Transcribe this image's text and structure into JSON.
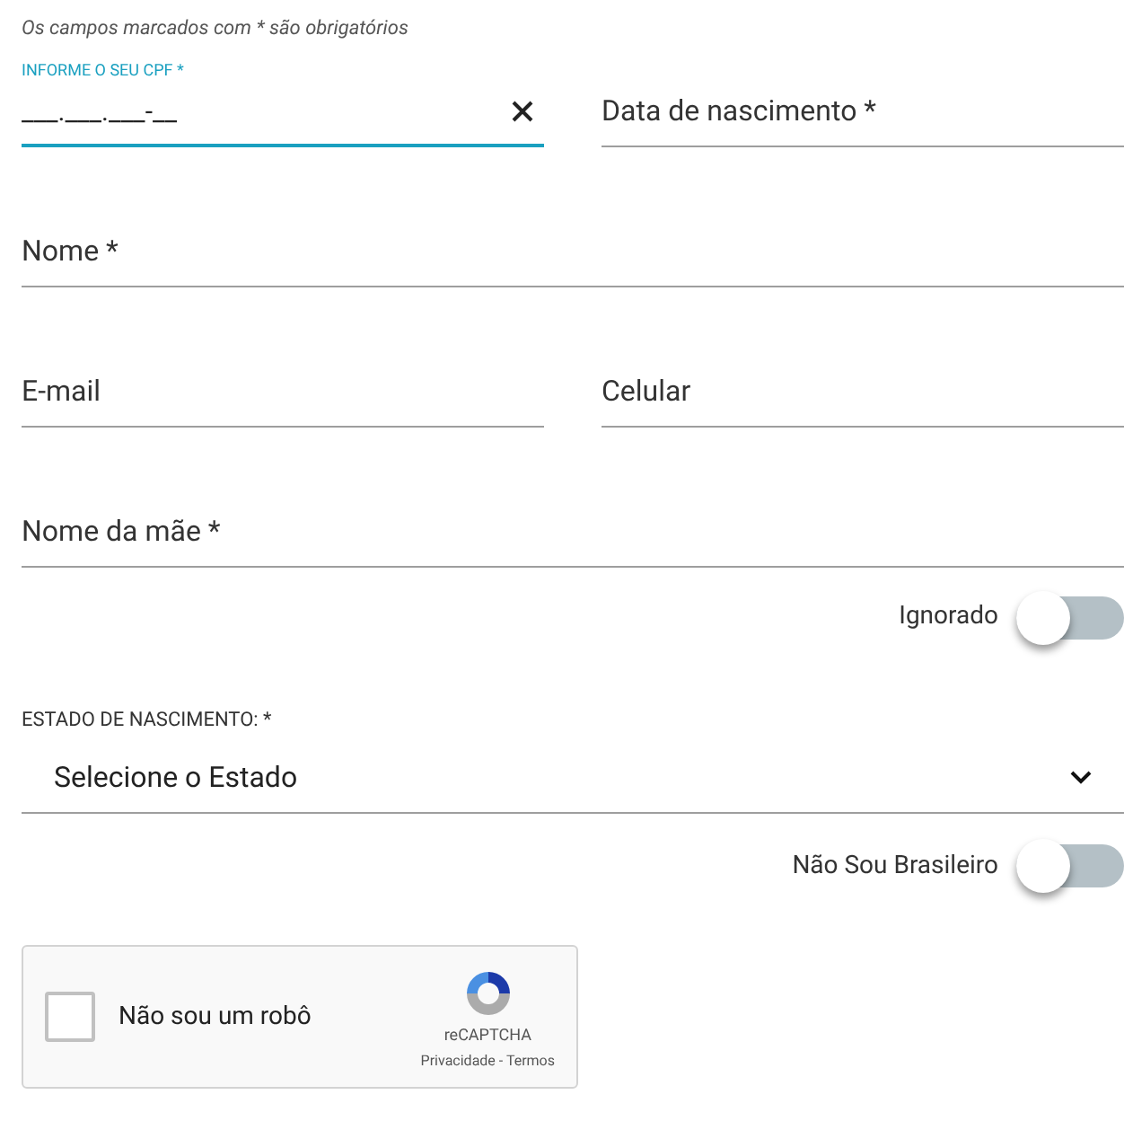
{
  "note": "Os campos marcados com * são obrigatórios",
  "rows": [
    {
      "fields": [
        {
          "label": "INFORME O SEU CPF *",
          "value": "___.___.___-__",
          "focused": true,
          "clearable": true
        },
        {
          "label": "Data de nascimento *",
          "focused": false
        }
      ]
    },
    {
      "fields": [
        {
          "label": "Nome *",
          "focused": false
        }
      ]
    },
    {
      "fields": [
        {
          "label": "E-mail",
          "focused": false
        },
        {
          "label": "Celular",
          "focused": false
        }
      ]
    },
    {
      "fields": [
        {
          "label": "Nome da mãe *",
          "focused": false
        }
      ]
    }
  ],
  "toggle_ignored": {
    "label": "Ignorado",
    "on": false
  },
  "state_select": {
    "label": "ESTADO DE NASCIMENTO: *",
    "value": "Selecione o Estado"
  },
  "toggle_foreign": {
    "label": "Não Sou Brasileiro",
    "on": false
  },
  "captcha": {
    "label": "Não sou um robô",
    "checked": false,
    "brand": "reCAPTCHA",
    "links": "Privacidade - Termos"
  }
}
